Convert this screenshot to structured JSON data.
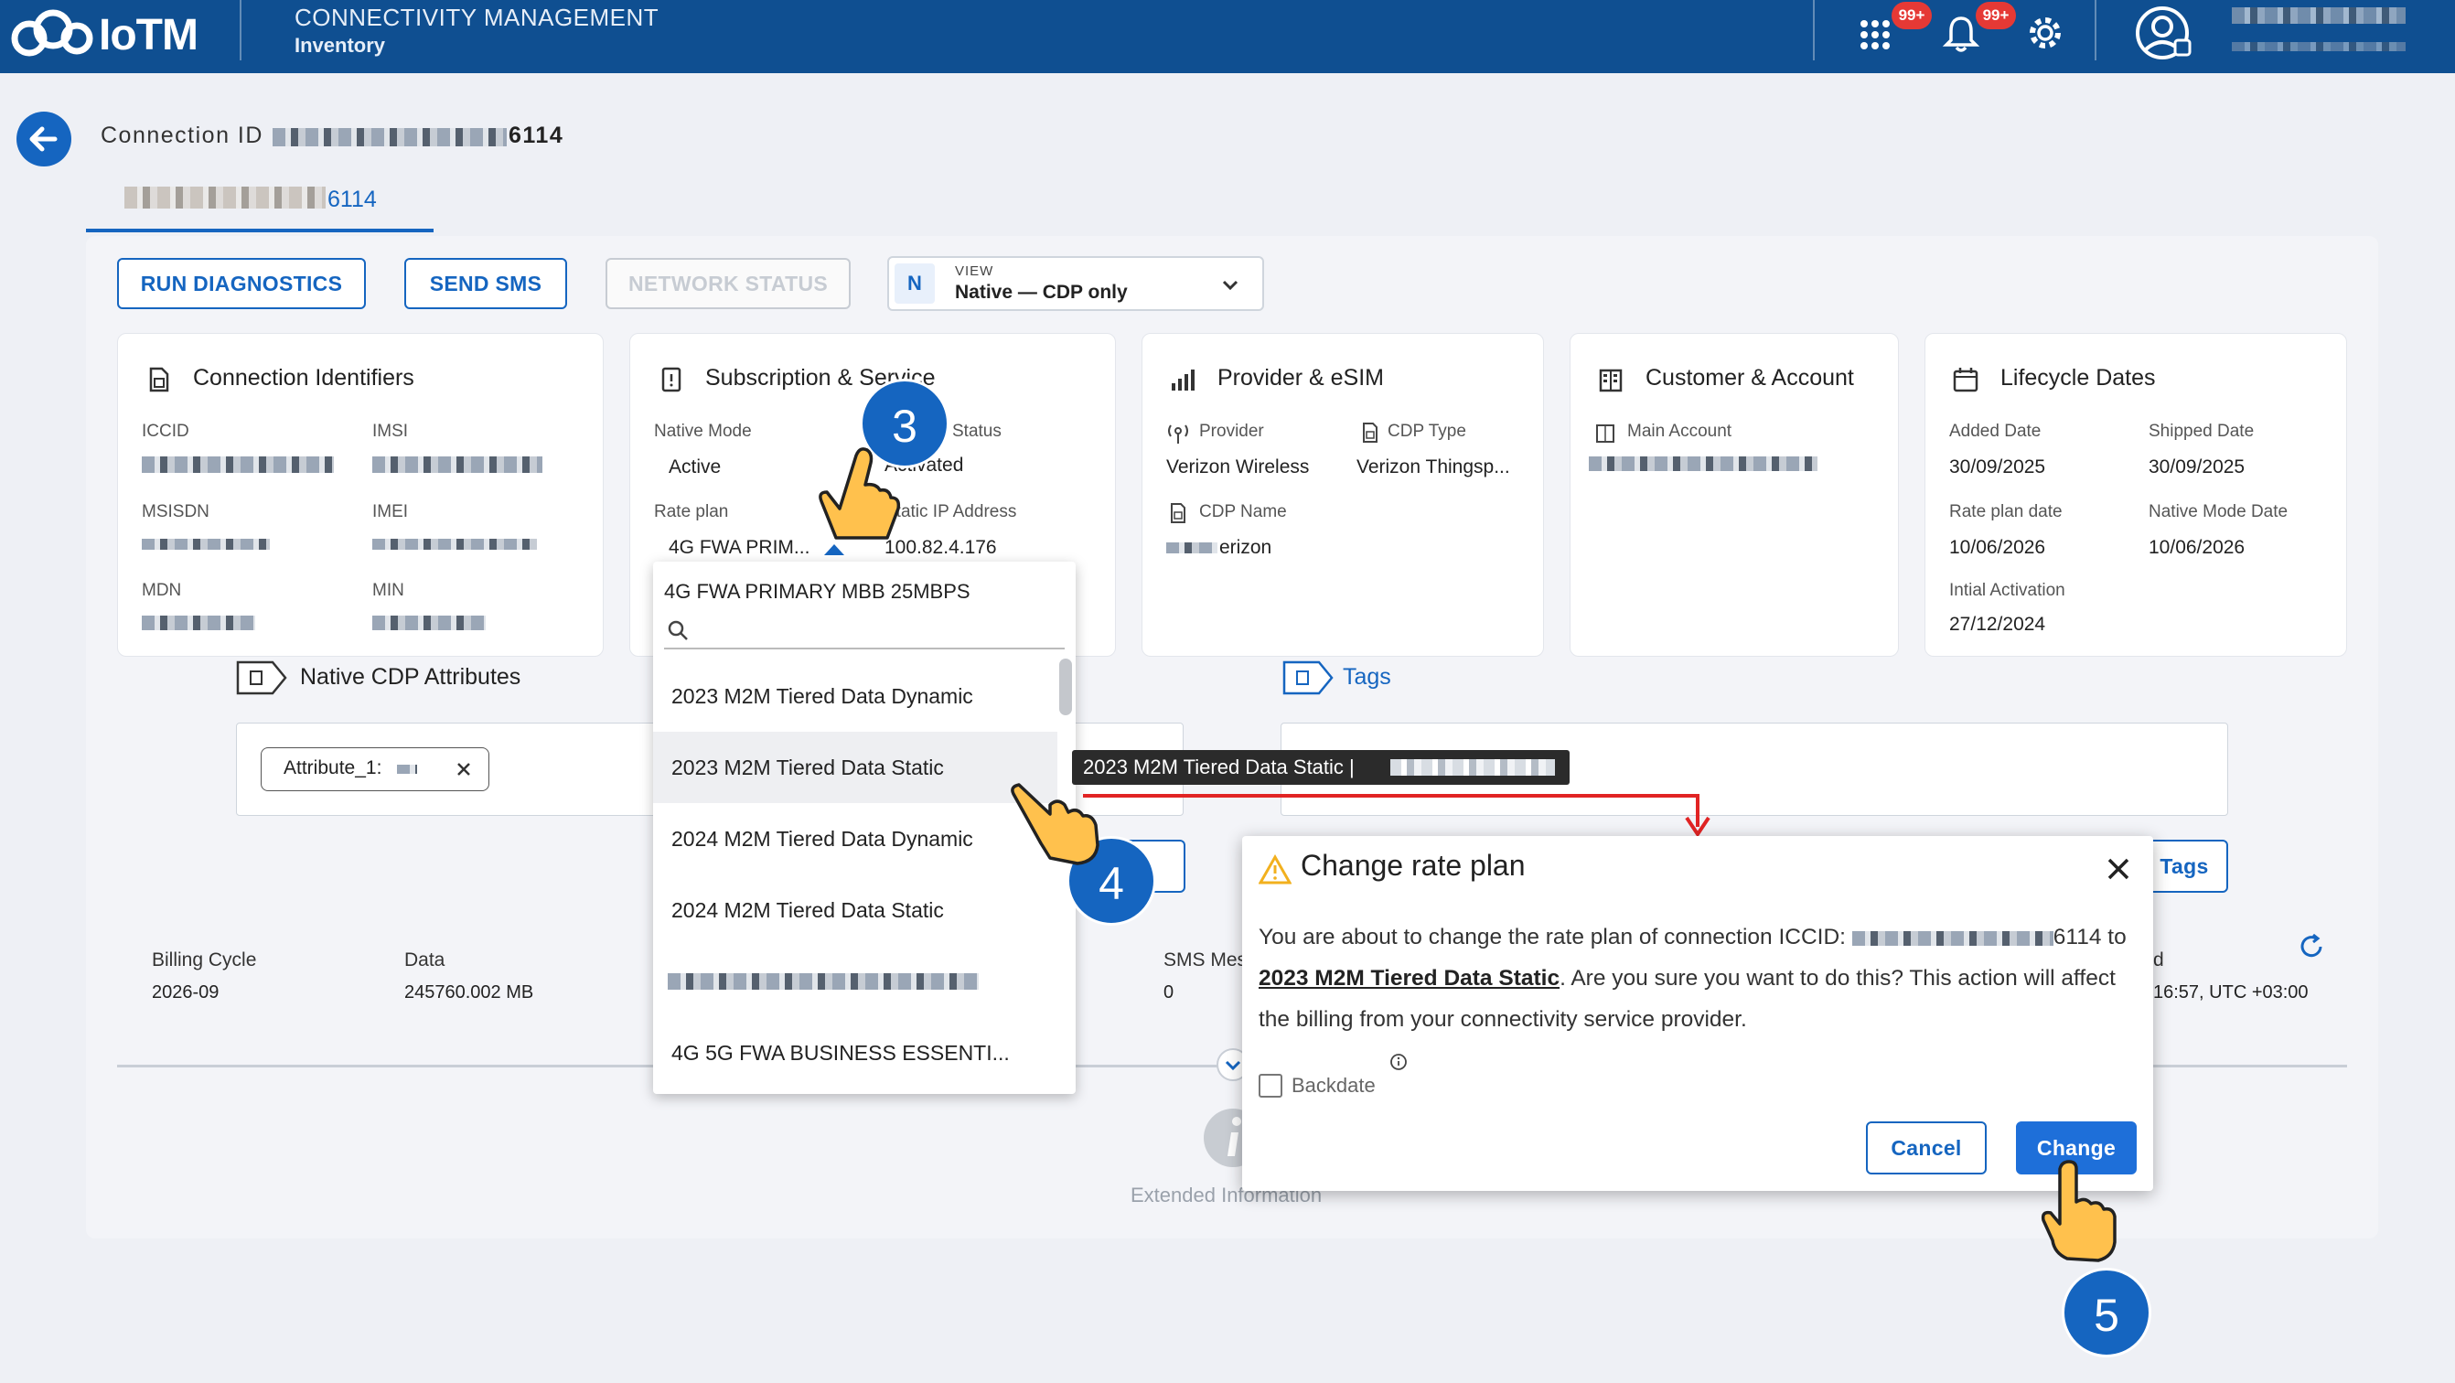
{
  "header": {
    "logo_text": "IoTM",
    "title": "CONNECTIVITY MANAGEMENT",
    "subtitle": "Inventory",
    "apps_badge": "99+",
    "notif_badge": "99+"
  },
  "page": {
    "connection_label": "Connection ID",
    "connection_suffix": "6114",
    "tab_suffix": "6114"
  },
  "actions": {
    "run_diagnostics": "RUN DIAGNOSTICS",
    "send_sms": "SEND SMS",
    "network_status": "NETWORK STATUS",
    "view_badge": "N",
    "view_label": "VIEW",
    "view_value": "Native — CDP only"
  },
  "cards": {
    "identifiers": {
      "title": "Connection Identifiers",
      "iccid": "ICCID",
      "imsi": "IMSI",
      "msisdn": "MSISDN",
      "imei": "IMEI",
      "mdn": "MDN",
      "min": "MIN"
    },
    "subscription": {
      "title": "Subscription & Service",
      "native_mode_label": "Native Mode",
      "native_mode": "Active",
      "status_label": "Status",
      "status_value": "Activated",
      "rate_plan_label": "Rate plan",
      "rate_plan_value": "4G FWA PRIM...",
      "static_ip_label": "Static IP Address",
      "static_ip": "100.82.4.176"
    },
    "provider": {
      "title": "Provider & eSIM",
      "provider_label": "Provider",
      "provider_value": "Verizon Wireless",
      "cdp_type_label": "CDP Type",
      "cdp_type_value": "Verizon Thingsp...",
      "cdp_name_label": "CDP Name",
      "cdp_name_value": "erizon"
    },
    "customer": {
      "title": "Customer & Account",
      "main_account_label": "Main Account"
    },
    "lifecycle": {
      "title": "Lifecycle Dates",
      "added_label": "Added Date",
      "added_value": "30/09/2025",
      "shipped_label": "Shipped Date",
      "shipped_value": "30/09/2025",
      "rate_plan_date_label": "Rate plan date",
      "rate_plan_date_value": "10/06/2026",
      "native_mode_date_label": "Native Mode Date",
      "native_mode_date_value": "10/06/2026",
      "activation_label": "Intial Activation",
      "activation_value": "27/12/2024"
    }
  },
  "native_cdp": {
    "title": "Native CDP Attributes",
    "chip": "Attribute_1:"
  },
  "tags": {
    "title": "Tags",
    "button": "Tags"
  },
  "billing": {
    "cycle_label": "Billing Cycle",
    "cycle_value": "2026-09",
    "data_label": "Data",
    "data_value": "245760.002 MB",
    "sms_label": "SMS Mes",
    "sms_value": "0",
    "time_label": "d",
    "time_value": "16:57, UTC +03:00"
  },
  "extended": {
    "label": "Extended Information"
  },
  "dropdown": {
    "selected": "4G FWA PRIMARY MBB 25MBPS",
    "search_placeholder": "",
    "items": [
      "2023 M2M Tiered Data Dynamic",
      "2023 M2M Tiered Data Static",
      "2024 M2M Tiered Data Dynamic",
      "2024 M2M Tiered Data Static",
      "",
      "4G 5G FWA BUSINESS ESSENTI..."
    ]
  },
  "tooltip": {
    "text": "2023 M2M Tiered Data Static |"
  },
  "modal": {
    "title": "Change rate plan",
    "body_prefix": "You are about to change the rate plan of connection ICCID:",
    "iccid_suffix": "6114",
    "to": "to",
    "plan": "2023 M2M Tiered Data Static",
    "body_suffix": ". Are you sure you want to do this? This action will affect the billing from your connectivity service provider.",
    "backdate": "Backdate",
    "cancel": "Cancel",
    "change": "Change"
  },
  "steps": {
    "s3": "3",
    "s4": "4",
    "s5": "5"
  },
  "colors": {
    "header": "#0f4f91",
    "primary": "#1565c0",
    "danger": "#e53935",
    "warning": "#f2b01e"
  }
}
